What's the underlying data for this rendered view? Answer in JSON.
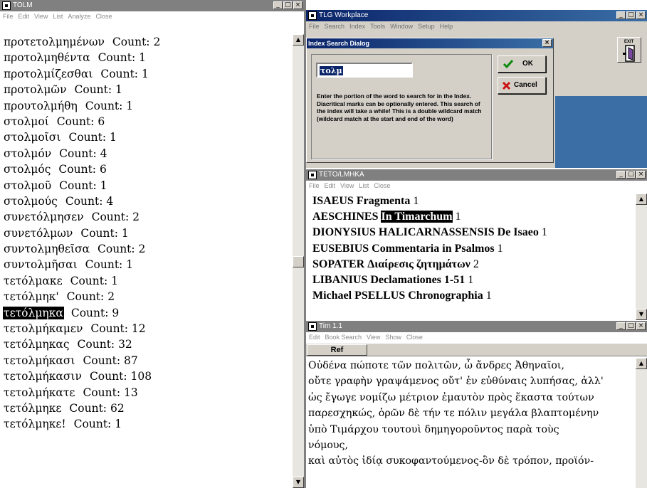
{
  "tolm_window": {
    "title": "TOLM",
    "menu": [
      "File",
      "Edit",
      "View",
      "List",
      "Analyze",
      "Close"
    ],
    "rows": [
      {
        "word": "προτετολμημένων",
        "count": "Count: 2"
      },
      {
        "word": "προτολμηθέντα",
        "count": "Count: 1"
      },
      {
        "word": "προτολμίζεσθαι",
        "count": "Count: 1"
      },
      {
        "word": "προτολμῶν",
        "count": "Count: 1"
      },
      {
        "word": "προυτολμήθη",
        "count": "Count: 1"
      },
      {
        "word": "στολμοί",
        "count": "Count: 6"
      },
      {
        "word": "στολμοῖσι",
        "count": "Count: 1"
      },
      {
        "word": "στολμόν",
        "count": "Count: 4"
      },
      {
        "word": "στολμός",
        "count": "Count: 6"
      },
      {
        "word": "στολμοῦ",
        "count": "Count: 1"
      },
      {
        "word": "στολμούς",
        "count": "Count: 4"
      },
      {
        "word": "συνετόλμησεν",
        "count": "Count: 2"
      },
      {
        "word": "συνετόλμων",
        "count": "Count: 1"
      },
      {
        "word": "συντολμηθεῖσα",
        "count": "Count: 2"
      },
      {
        "word": "συντολμῆσαι",
        "count": "Count: 1"
      },
      {
        "word": "τετόλμακε",
        "count": "Count: 1"
      },
      {
        "word": "τετόλμηκ'",
        "count": "Count: 2"
      },
      {
        "word": "τετόλμηκα",
        "count": "Count: 9"
      },
      {
        "word": "τετολμήκαμεν",
        "count": "Count: 12"
      },
      {
        "word": "τετόλμηκας",
        "count": "Count: 32"
      },
      {
        "word": "τετολμήκασι",
        "count": "Count: 87"
      },
      {
        "word": "τετολμήκασιν",
        "count": "Count: 108"
      },
      {
        "word": "τετολμήκατε",
        "count": "Count: 13"
      },
      {
        "word": "τετόλμηκε",
        "count": "Count: 62"
      },
      {
        "word": "τετόλμηκε!",
        "count": "Count: 1"
      }
    ]
  },
  "workplace_window": {
    "title": "TLG Workplace",
    "menu": [
      "File",
      "Search",
      "Index",
      "Tools",
      "Window",
      "Setup",
      "Help"
    ],
    "exit_label": "EXIT"
  },
  "dialog": {
    "title": "Index Search Dialog",
    "input_value": "τολμ",
    "ok_label": "OK",
    "cancel_label": "Cancel",
    "instructions": "Enter the portion of the word to search for in the Index. Diacritical marks can be optionally entered. This search of the index will take a while! This is a double wildcard match (wildcard match at the start and end of the word)"
  },
  "results_window": {
    "title": "TETO/LMHKA",
    "menu": [
      "File",
      "Edit",
      "View",
      "List",
      "Close"
    ],
    "rows": [
      {
        "author": "ISAEUS",
        "work": "Fragmenta",
        "count": "1"
      },
      {
        "author": "AESCHINES",
        "work": "In Timarchum",
        "count": "1"
      },
      {
        "author": "DIONYSIUS HALICARNASSENSIS",
        "work": "De Isaeo",
        "count": "1"
      },
      {
        "author": "EUSEBIUS",
        "work": "Commentaria in Psalmos",
        "count": "1"
      },
      {
        "author": "SOPATER",
        "work": "Διαίρεσις ζητημάτων",
        "count": "2"
      },
      {
        "author": "LIBANIUS",
        "work": "Declamationes 1-51",
        "count": "1"
      },
      {
        "author": "Michael PSELLUS",
        "work": "Chronographia",
        "count": "1"
      }
    ]
  },
  "text_window": {
    "title": "Tim 1.1",
    "menu": [
      "Edit",
      "Book Search",
      "View",
      "Show",
      "Close"
    ],
    "ref_label": "Ref",
    "lines": [
      "Οὐδένα πώποτε τῶν πολιτῶν, ὦ ἄνδρες Ἀθηναῖοι,",
      "οὔτε γραφὴν γραψάμενος οὔτ' ἐν εὐθύναις λυπήσας, ἀλλ'",
      "ὡς ἔγωγε νομίζω μέτριον ἐμαυτὸν πρὸς ἕκαστα τούτων",
      "παρεσχηκώς, ὁρῶν δὲ τήν τε πόλιν μεγάλα βλαπτομένην",
      "ὑπὸ Τιμάρχου τουτουὶ δημηγοροῦντος παρὰ τοὺς",
      "νόμους,",
      "καὶ αὐτὸς ἰδίᾳ συκοφαντούμενος-ὃν δὲ τρόπον, προϊόν-"
    ]
  }
}
